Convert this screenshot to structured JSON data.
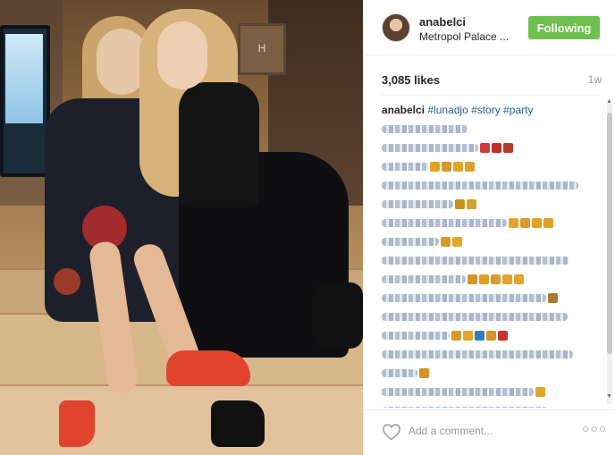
{
  "post": {
    "username": "anabelci",
    "location": "Metropol Palace ...",
    "follow_label": "Following",
    "likes": "3,085 likes",
    "age": "1w",
    "caption_user": "anabelci",
    "hashtags": [
      "#lunadjo",
      "#story",
      "#party"
    ],
    "photo_plaque_text": "H"
  },
  "comment_box": {
    "placeholder": "Add a comment..."
  },
  "icons": {
    "heart": "heart-icon",
    "more": "more-options-icon",
    "avatar": "avatar"
  },
  "colors": {
    "follow_button": "#70c050",
    "hashtag": "#275f91",
    "muted_text": "#999999"
  }
}
